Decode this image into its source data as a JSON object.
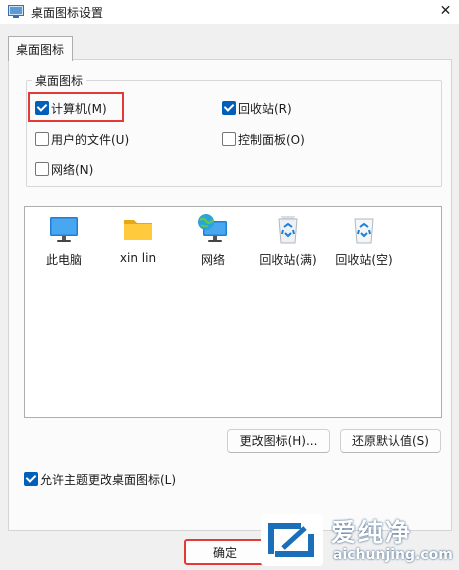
{
  "window": {
    "title": "桌面图标设置",
    "close_glyph": "✕"
  },
  "tabs": [
    {
      "label": "桌面图标",
      "active": true
    }
  ],
  "desktop_icons_group": {
    "legend": "桌面图标",
    "checkboxes": [
      {
        "label": "计算机(M)",
        "checked": true
      },
      {
        "label": "回收站(R)",
        "checked": true
      },
      {
        "label": "用户的文件(U)",
        "checked": false
      },
      {
        "label": "控制面板(O)",
        "checked": false
      },
      {
        "label": "网络(N)",
        "checked": false
      }
    ]
  },
  "icon_list": [
    {
      "label": "此电脑",
      "icon": "monitor-icon"
    },
    {
      "label": "xin lin",
      "icon": "folder-icon"
    },
    {
      "label": "网络",
      "icon": "network-icon"
    },
    {
      "label": "回收站(满)",
      "icon": "recycle-bin-full-icon"
    },
    {
      "label": "回收站(空)",
      "icon": "recycle-bin-empty-icon"
    }
  ],
  "buttons": {
    "change_icon": "更改图标(H)...",
    "restore_default": "还原默认值(S)",
    "ok": "确定"
  },
  "allow_themes": {
    "label": "允许主题更改桌面图标(L)",
    "checked": true
  },
  "watermark": {
    "brand": "爱纯净",
    "url": "aichunjing.com"
  },
  "colors": {
    "accent": "#005fb8",
    "highlight_red": "#e53935",
    "watermark_blue": "#1a6fb8"
  }
}
